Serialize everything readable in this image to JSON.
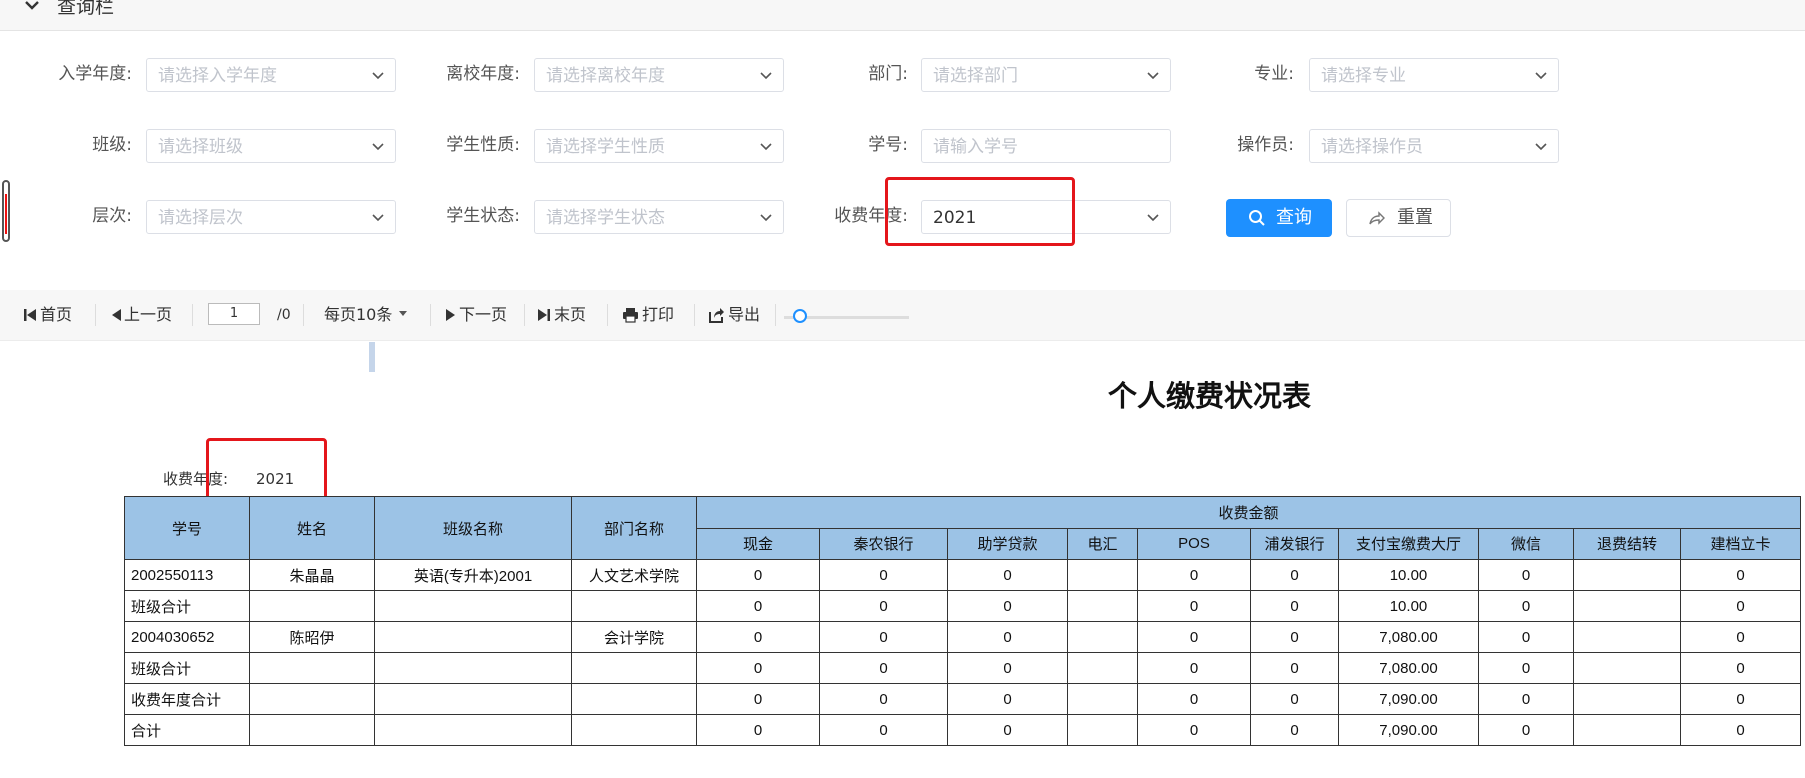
{
  "query_panel": {
    "title": "查询栏",
    "fields": {
      "enroll_year": {
        "label": "入学年度:",
        "placeholder": "请选择入学年度"
      },
      "leave_year": {
        "label": "离校年度:",
        "placeholder": "请选择离校年度"
      },
      "department": {
        "label": "部门:",
        "placeholder": "请选择部门"
      },
      "major": {
        "label": "专业:",
        "placeholder": "请选择专业"
      },
      "class": {
        "label": "班级:",
        "placeholder": "请选择班级"
      },
      "student_type": {
        "label": "学生性质:",
        "placeholder": "请选择学生性质"
      },
      "student_id": {
        "label": "学号:",
        "placeholder": "请输入学号"
      },
      "operator": {
        "label": "操作员:",
        "placeholder": "请选择操作员"
      },
      "level": {
        "label": "层次:",
        "placeholder": "请选择层次"
      },
      "student_status": {
        "label": "学生状态:",
        "placeholder": "请选择学生状态"
      },
      "fee_year": {
        "label": "收费年度:",
        "value": "2021"
      }
    },
    "search_label": "查询",
    "reset_label": "重置"
  },
  "toolbar": {
    "first": "首页",
    "prev": "上一页",
    "page_value": "1",
    "page_total": "/0",
    "per_page": "每页10条",
    "next": "下一页",
    "last": "末页",
    "print": "打印",
    "export": "导出",
    "zoom_fraction": 0.1
  },
  "report": {
    "title": "个人缴费状况表",
    "fee_year_label": "收费年度:",
    "fee_year_value": "2021",
    "headers": {
      "student_id": "学号",
      "name": "姓名",
      "class_name": "班级名称",
      "dept_name": "部门名称",
      "amount_group": "收费金额",
      "amount_cols": [
        "现金",
        "秦农银行",
        "助学贷款",
        "电汇",
        "POS",
        "浦发银行",
        "支付宝缴费大厅",
        "微信",
        "退费结转",
        "建档立卡"
      ]
    },
    "rows": [
      {
        "c": [
          "2002550113",
          "朱晶晶",
          "英语(专升本)2001",
          "人文艺术学院",
          "0",
          "0",
          "0",
          "",
          "0",
          "0",
          "10.00",
          "0",
          "",
          "0"
        ]
      },
      {
        "c": [
          "班级合计",
          "",
          "",
          "",
          "0",
          "0",
          "0",
          "",
          "0",
          "0",
          "10.00",
          "0",
          "",
          "0"
        ]
      },
      {
        "c": [
          "2004030652",
          "陈昭伊",
          "",
          "会计学院",
          "0",
          "0",
          "0",
          "",
          "0",
          "0",
          "7,080.00",
          "0",
          "",
          "0"
        ]
      },
      {
        "c": [
          "班级合计",
          "",
          "",
          "",
          "0",
          "0",
          "0",
          "",
          "0",
          "0",
          "7,080.00",
          "0",
          "",
          "0"
        ]
      },
      {
        "c": [
          "收费年度合计",
          "",
          "",
          "",
          "0",
          "0",
          "0",
          "",
          "0",
          "0",
          "7,090.00",
          "0",
          "",
          "0"
        ]
      },
      {
        "c": [
          "合计",
          "",
          "",
          "",
          "0",
          "0",
          "0",
          "",
          "0",
          "0",
          "7,090.00",
          "0",
          "",
          "0"
        ]
      }
    ]
  },
  "colors": {
    "primary": "#1e90ff",
    "highlight": "#e4161b",
    "table_header": "#9cc3e6"
  }
}
